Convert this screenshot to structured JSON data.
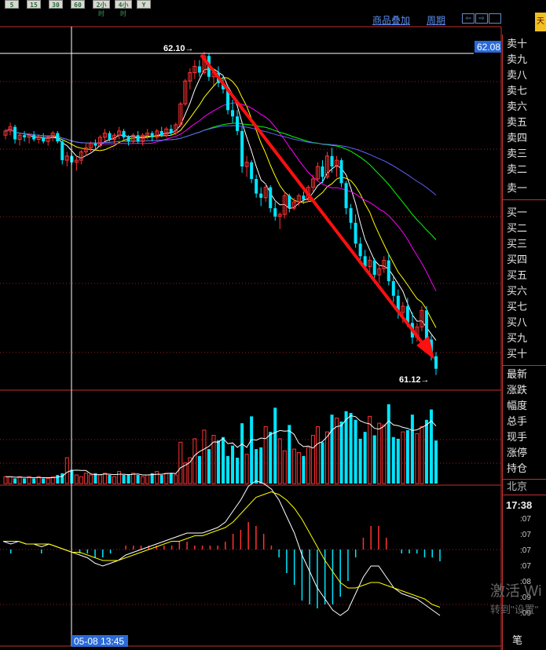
{
  "period_tabs": [
    "5",
    "15",
    "30",
    "60",
    "2小时",
    "4小时",
    "Y"
  ],
  "toolbar": {
    "overlay_label": "商品叠加",
    "period_label": "周期",
    "nav_left": "⇦",
    "nav_right": "⇨"
  },
  "brand_char": "天",
  "order_panel": {
    "sell_levels": [
      "卖十",
      "卖九",
      "卖八",
      "卖七",
      "卖六",
      "卖五",
      "卖四",
      "卖三",
      "卖二",
      "卖一"
    ],
    "buy_levels": [
      "买一",
      "买二",
      "买三",
      "买四",
      "买五",
      "买六",
      "买七",
      "买八",
      "买九",
      "买十"
    ],
    "quote_fields": [
      "最新",
      "涨跌",
      "幅度",
      "总手",
      "现手",
      "涨停",
      "持仓"
    ],
    "city": "北京",
    "time": "17:38",
    "tick_rows": [
      ":07",
      ":07",
      ":07",
      ":07",
      ":08",
      ":09",
      ":09"
    ],
    "footer_label": "笔"
  },
  "watermark": {
    "line1": "激活 Wi",
    "line2": "转到\"设置\""
  },
  "chart_data": {
    "type": "candlestick",
    "current_price_label": "62.08",
    "high_marker": "62.10",
    "low_marker": "61.12",
    "crosshair_time_label": "05-08 13:45",
    "price_range": [
      60.97,
      62.16
    ],
    "candles": [
      [
        61.7,
        61.73,
        61.68,
        61.72
      ],
      [
        61.72,
        61.76,
        61.7,
        61.74
      ],
      [
        61.74,
        61.75,
        61.66,
        61.68
      ],
      [
        61.68,
        61.71,
        61.65,
        61.7
      ],
      [
        61.7,
        61.72,
        61.67,
        61.69
      ],
      [
        61.69,
        61.71,
        61.66,
        61.7
      ],
      [
        61.7,
        61.72,
        61.67,
        61.68
      ],
      [
        61.68,
        61.7,
        61.66,
        61.69
      ],
      [
        61.69,
        61.71,
        61.66,
        61.67
      ],
      [
        61.67,
        61.7,
        61.65,
        61.69
      ],
      [
        61.69,
        61.72,
        61.67,
        61.71
      ],
      [
        61.71,
        61.72,
        61.66,
        61.67
      ],
      [
        61.67,
        61.68,
        61.56,
        61.58
      ],
      [
        61.58,
        61.62,
        61.55,
        61.6
      ],
      [
        61.6,
        61.61,
        61.56,
        61.57
      ],
      [
        61.57,
        61.6,
        61.53,
        61.58
      ],
      [
        61.58,
        61.63,
        61.56,
        61.62
      ],
      [
        61.62,
        61.66,
        61.6,
        61.64
      ],
      [
        61.64,
        61.67,
        61.62,
        61.66
      ],
      [
        61.66,
        61.68,
        61.63,
        61.65
      ],
      [
        61.65,
        61.7,
        61.64,
        61.69
      ],
      [
        61.69,
        61.73,
        61.67,
        61.71
      ],
      [
        61.71,
        61.72,
        61.67,
        61.68
      ],
      [
        61.68,
        61.71,
        61.66,
        61.7
      ],
      [
        61.7,
        61.74,
        61.68,
        61.72
      ],
      [
        61.72,
        61.73,
        61.68,
        61.69
      ],
      [
        61.69,
        61.7,
        61.65,
        61.67
      ],
      [
        61.67,
        61.71,
        61.66,
        61.7
      ],
      [
        61.7,
        61.72,
        61.66,
        61.67
      ],
      [
        61.67,
        61.71,
        61.65,
        61.7
      ],
      [
        61.7,
        61.73,
        61.68,
        61.71
      ],
      [
        61.71,
        61.72,
        61.67,
        61.69
      ],
      [
        61.69,
        61.73,
        61.68,
        61.72
      ],
      [
        61.72,
        61.74,
        61.69,
        61.7
      ],
      [
        61.7,
        61.74,
        61.69,
        61.73
      ],
      [
        61.73,
        61.75,
        61.7,
        61.71
      ],
      [
        61.71,
        61.76,
        61.7,
        61.75
      ],
      [
        61.75,
        61.86,
        61.74,
        61.85
      ],
      [
        61.85,
        61.97,
        61.84,
        61.96
      ],
      [
        61.96,
        62.02,
        61.92,
        62.0
      ],
      [
        62.0,
        62.06,
        61.97,
        62.03
      ],
      [
        62.03,
        62.06,
        61.98,
        62.0
      ],
      [
        62.0,
        62.1,
        61.99,
        62.08
      ],
      [
        62.08,
        62.09,
        61.96,
        61.98
      ],
      [
        61.98,
        62.02,
        61.94,
        62.0
      ],
      [
        62.0,
        62.03,
        61.93,
        61.95
      ],
      [
        61.95,
        61.99,
        61.9,
        61.92
      ],
      [
        61.92,
        61.94,
        61.8,
        61.82
      ],
      [
        61.82,
        61.87,
        61.76,
        61.79
      ],
      [
        61.79,
        61.82,
        61.7,
        61.72
      ],
      [
        61.72,
        61.74,
        61.52,
        61.55
      ],
      [
        61.55,
        61.6,
        61.5,
        61.57
      ],
      [
        61.57,
        61.58,
        61.47,
        61.49
      ],
      [
        61.49,
        61.51,
        61.4,
        61.42
      ],
      [
        61.42,
        61.45,
        61.36,
        61.4
      ],
      [
        61.4,
        61.47,
        61.38,
        61.45
      ],
      [
        61.45,
        61.46,
        61.33,
        61.35
      ],
      [
        61.35,
        61.38,
        61.29,
        61.31
      ],
      [
        61.31,
        61.33,
        61.25,
        61.32
      ],
      [
        61.32,
        61.43,
        61.3,
        61.41
      ],
      [
        61.41,
        61.42,
        61.33,
        61.35
      ],
      [
        61.35,
        61.4,
        61.34,
        61.38
      ],
      [
        61.38,
        61.42,
        61.36,
        61.41
      ],
      [
        61.41,
        61.43,
        61.37,
        61.39
      ],
      [
        61.39,
        61.46,
        61.38,
        61.45
      ],
      [
        61.45,
        61.51,
        61.43,
        61.49
      ],
      [
        61.49,
        61.57,
        61.48,
        61.55
      ],
      [
        61.55,
        61.58,
        61.47,
        61.5
      ],
      [
        61.5,
        61.62,
        61.49,
        61.6
      ],
      [
        61.6,
        61.64,
        61.52,
        61.55
      ],
      [
        61.55,
        61.6,
        61.5,
        61.58
      ],
      [
        61.58,
        61.59,
        61.45,
        61.47
      ],
      [
        61.47,
        61.48,
        61.32,
        61.35
      ],
      [
        61.35,
        61.37,
        61.25,
        61.28
      ],
      [
        61.28,
        61.32,
        61.16,
        61.18
      ],
      [
        61.18,
        61.21,
        61.1,
        61.12
      ],
      [
        61.12,
        61.15,
        61.05,
        61.07
      ],
      [
        61.07,
        61.12,
        61.02,
        61.1
      ],
      [
        61.1,
        61.11,
        61.0,
        61.03
      ],
      [
        61.03,
        61.08,
        60.99,
        61.06
      ],
      [
        61.06,
        61.12,
        61.04,
        61.1
      ],
      [
        61.1,
        61.13,
        60.98,
        61.0
      ],
      [
        61.0,
        61.02,
        60.9,
        60.93
      ],
      [
        60.93,
        60.96,
        60.82,
        60.85
      ],
      [
        60.85,
        60.9,
        60.8,
        60.88
      ],
      [
        60.88,
        60.92,
        60.78,
        60.8
      ],
      [
        60.8,
        60.85,
        60.7,
        60.73
      ],
      [
        60.73,
        60.8,
        60.71,
        60.78
      ],
      [
        60.78,
        60.88,
        60.76,
        60.86
      ],
      [
        60.86,
        60.88,
        60.7,
        60.72
      ],
      [
        60.72,
        60.74,
        60.62,
        60.64
      ],
      [
        60.64,
        60.66,
        60.55,
        60.58
      ]
    ],
    "volume": [
      4,
      4,
      3,
      4,
      3,
      4,
      3,
      4,
      3,
      3,
      4,
      5,
      6,
      15,
      8,
      5,
      4,
      6,
      5,
      6,
      5,
      6,
      5,
      4,
      7,
      5,
      5,
      6,
      5,
      4,
      5,
      6,
      7,
      5,
      6,
      6,
      5,
      24,
      12,
      15,
      26,
      16,
      31,
      20,
      28,
      25,
      27,
      16,
      22,
      15,
      35,
      17,
      39,
      20,
      21,
      33,
      30,
      44,
      26,
      19,
      34,
      20,
      18,
      16,
      21,
      28,
      33,
      24,
      30,
      40,
      38,
      36,
      42,
      41,
      37,
      26,
      30,
      39,
      28,
      35,
      34,
      46,
      27,
      26,
      30,
      31,
      40,
      29,
      33,
      37,
      43,
      25
    ],
    "macd_dif": [
      3,
      2,
      3,
      2,
      2,
      1,
      2,
      1,
      0,
      -1,
      -2,
      -3,
      -5,
      -6,
      -5,
      -4,
      -2,
      -1,
      0,
      1,
      2,
      3,
      4,
      5,
      6,
      6,
      6,
      7,
      8,
      10,
      14,
      18,
      23,
      25,
      24,
      22,
      18,
      12,
      6,
      -2,
      -8,
      -14,
      -18,
      -22,
      -24,
      -22,
      -16,
      -10,
      -6,
      -6,
      -10,
      -14,
      -16,
      -17,
      -18,
      -20,
      -22,
      -24
    ],
    "macd_dea": [
      3,
      3,
      3,
      2,
      2,
      2,
      2,
      1,
      0,
      -1,
      -1,
      -2,
      -3,
      -4,
      -4,
      -4,
      -3,
      -2,
      -1,
      0,
      1,
      2,
      3,
      3,
      4,
      5,
      5,
      6,
      7,
      8,
      10,
      13,
      16,
      19,
      20,
      21,
      20,
      18,
      15,
      11,
      6,
      1,
      -4,
      -8,
      -12,
      -14,
      -14,
      -13,
      -12,
      -12,
      -13,
      -14,
      -15,
      -16,
      -17,
      -18,
      -20,
      -21
    ],
    "ma_colors": [
      "#ffffff",
      "#ffff00",
      "#ff00ff",
      "#00ff00",
      "#6060ff"
    ]
  }
}
